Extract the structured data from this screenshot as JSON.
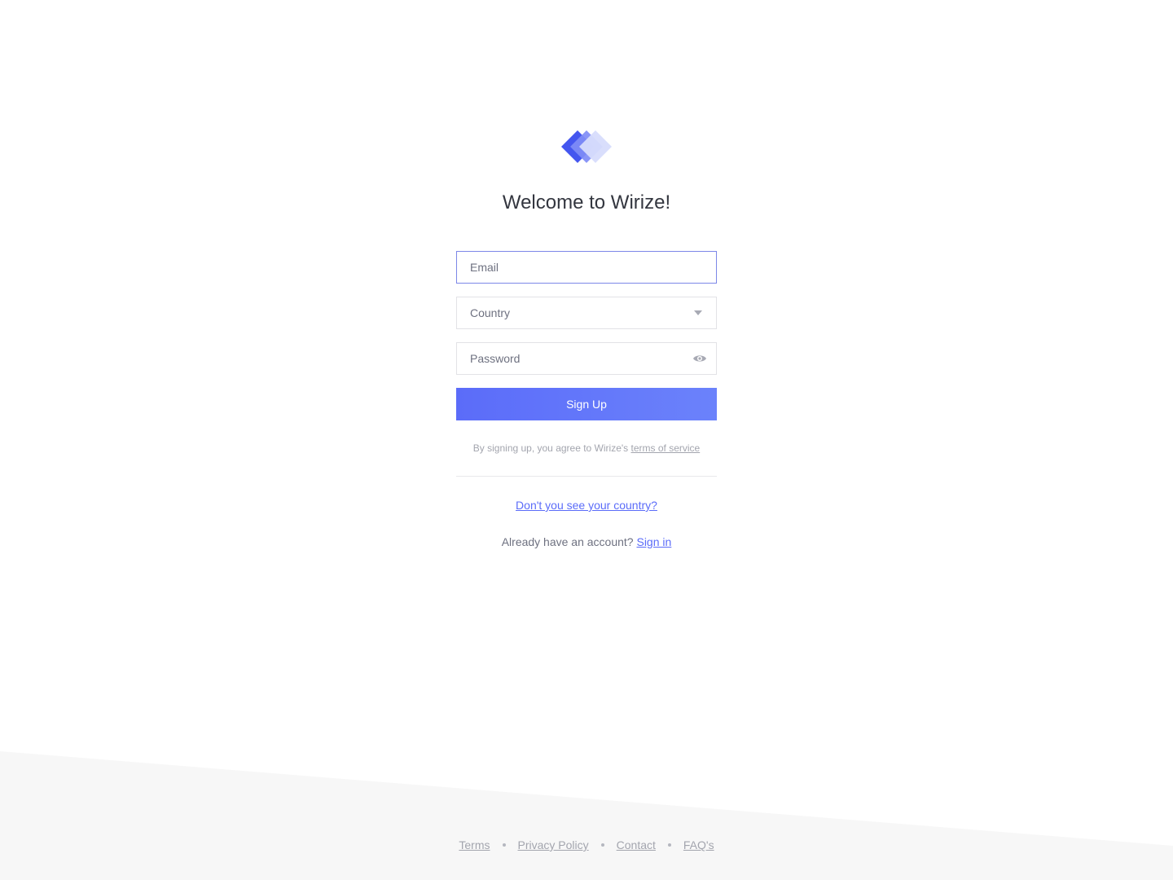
{
  "app": {
    "title": "Welcome to Wirize!",
    "logo": "wirize-diamond-logo"
  },
  "form": {
    "email_placeholder": "Email",
    "country_placeholder": "Country",
    "password_placeholder": "Password",
    "submit_label": "Sign Up"
  },
  "terms": {
    "prefix": "By signing up, you agree to Wirize's ",
    "link": "terms of service"
  },
  "links": {
    "country_help": "Don't you see your country?",
    "signin_prefix": "Already have an account? ",
    "signin_link": "Sign in"
  },
  "footer": {
    "terms": "Terms",
    "privacy": "Privacy Policy",
    "contact": "Contact",
    "faqs": "FAQ's"
  },
  "icons": {
    "country_caret": "chevron-down-icon",
    "password_toggle": "eye-icon"
  },
  "colors": {
    "accent": "#5b6cf9",
    "title": "#33363f",
    "muted": "#a3a5ae",
    "footer_bg": "#f7f7f7"
  }
}
